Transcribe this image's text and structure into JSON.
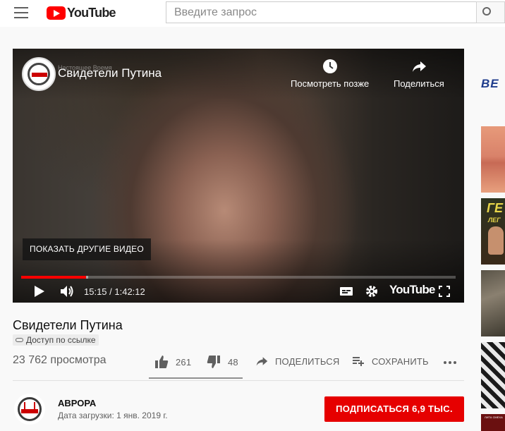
{
  "masthead": {
    "logo_text": "YouTube",
    "search_placeholder": "Введите запрос"
  },
  "player": {
    "title": "Свидетели Путина",
    "channel_watermark": "Настоящее Время",
    "watch_later_label": "Посмотреть позже",
    "share_label": "Поделиться",
    "more_videos_label": "ПОКАЗАТЬ ДРУГИЕ ВИДЕО",
    "time_display": "15:15 / 1:42:12",
    "played_fraction": 0.149,
    "loaded_fraction": 0.155,
    "youtube_word": "YouTube"
  },
  "video": {
    "title": "Свидетели Путина",
    "visibility_label": "Доступ по ссылке",
    "views": "23 762 просмотра",
    "likes": "261",
    "dislikes": "48",
    "share_label": "ПОДЕЛИТЬСЯ",
    "save_label": "СОХРАНИТЬ"
  },
  "owner": {
    "name": "АВРОРА",
    "upload_date": "Дата загрузки: 1 янв. 2019 г.",
    "subscribe_label": "ПОДПИСАТЬСЯ",
    "subscriber_count": "6,9 ТЫС."
  },
  "sidebar": {
    "ad_text": "BE",
    "thumb2_title": "ГЕ",
    "thumb2_subtitle": "ЛЕГ",
    "thumb5_label": "ЛИТА СМЕХА"
  },
  "colors": {
    "brand_red": "#ff0000",
    "subscribe_red": "#e60000",
    "progress_red": "#ff0000"
  },
  "icons": [
    "menu-icon",
    "search-icon",
    "clock-icon",
    "share-icon",
    "play-icon",
    "volume-icon",
    "subtitles-icon",
    "gear-icon",
    "fullscreen-icon",
    "thumb-up-icon",
    "thumb-down-icon",
    "playlist-add-icon",
    "more-icon",
    "link-icon"
  ]
}
